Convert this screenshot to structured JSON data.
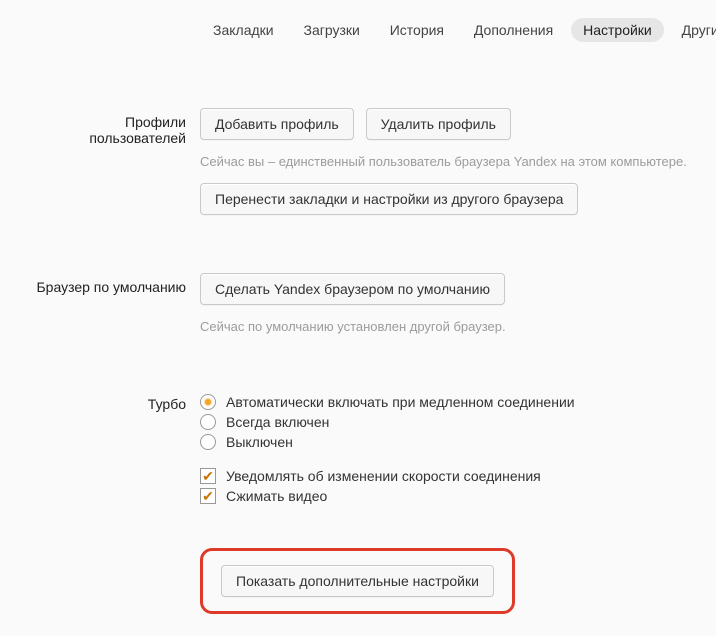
{
  "tabs": {
    "bookmarks": "Закладки",
    "downloads": "Загрузки",
    "history": "История",
    "addons": "Дополнения",
    "settings": "Настройки",
    "other": "Другие устр"
  },
  "profiles": {
    "label_line1": "Профили",
    "label_line2": "пользователей",
    "add_btn": "Добавить профиль",
    "delete_btn": "Удалить профиль",
    "hint": "Сейчас вы – единственный пользователь браузера Yandex на этом компьютере.",
    "import_btn": "Перенести закладки и настройки из другого браузера"
  },
  "default_browser": {
    "label": "Браузер по умолчанию",
    "set_btn": "Сделать Yandex браузером по умолчанию",
    "hint": "Сейчас по умолчанию установлен другой браузер."
  },
  "turbo": {
    "label": "Турбо",
    "opt_auto": "Автоматически включать при медленном соединении",
    "opt_always": "Всегда включен",
    "opt_off": "Выключен",
    "notify": "Уведомлять об изменении скорости соединения",
    "compress": "Сжимать видео"
  },
  "advanced_btn": "Показать дополнительные настройки"
}
